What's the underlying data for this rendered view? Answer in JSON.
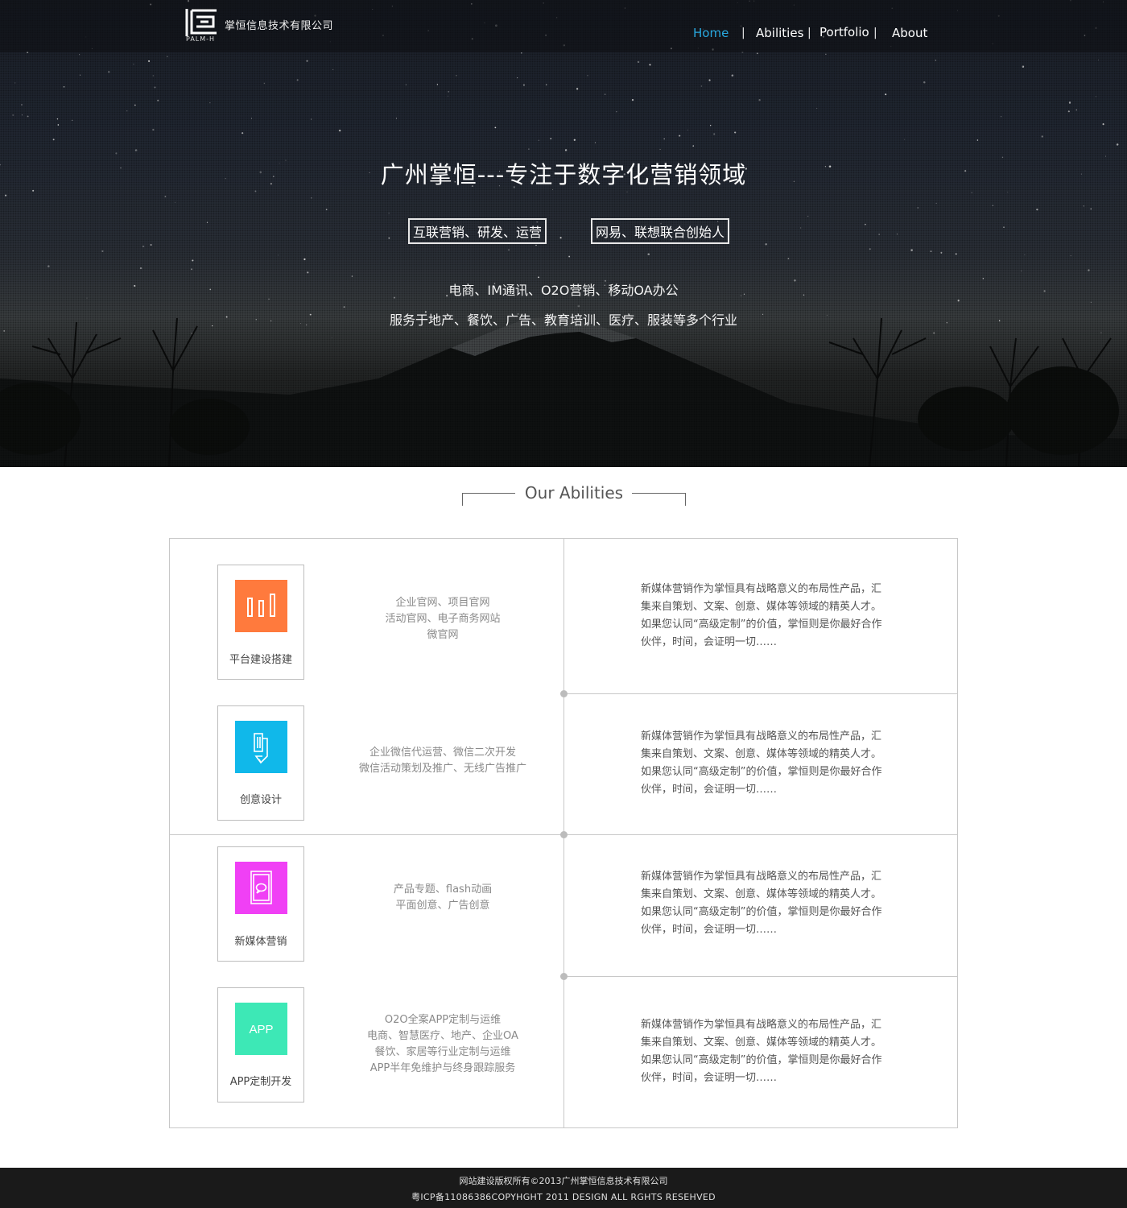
{
  "header": {
    "logo_sub": "PALM-H",
    "brand": "掌恒信息技术有限公司",
    "nav": [
      {
        "label": "Home",
        "active": true
      },
      {
        "label": "Abilities",
        "active": false
      },
      {
        "label": "Portfolio",
        "active": false
      },
      {
        "label": "About",
        "active": false
      }
    ],
    "separator": "|"
  },
  "hero": {
    "title": "广州掌恒---专注于数字化营销领域",
    "tags": [
      "互联营销、研发、运营",
      "网易、联想联合创始人"
    ],
    "lines": [
      "电商、IM通讯、O2O营销、移动OA办公",
      "服务于地产、餐饮、广告、教育培训、医疗、服装等多个行业"
    ]
  },
  "abilities": {
    "title": "Our Abilities",
    "items": [
      {
        "icon": "bar-chart-icon",
        "color": "#ff7a3d",
        "label": "平台建设搭建",
        "desc": [
          "企业官网、项目官网",
          "活动官网、电子商务网站",
          "微官网"
        ],
        "para": "新媒体营销作为掌恒具有战略意义的布局性产品，汇集来自策划、文案、创意、媒体等领域的精英人才。如果您认同“高级定制”的价值，掌恒则是你最好合作伙伴，时间，会证明一切……"
      },
      {
        "icon": "pencil-icon",
        "color": "#10b8ea",
        "label": "创意设计",
        "desc": [
          "企业微信代运营、微信二次开发",
          "微信活动策划及推广、无线广告推广"
        ],
        "para": "新媒体营销作为掌恒具有战略意义的布局性产品，汇集来自策划、文案、创意、媒体等领域的精英人才。如果您认同“高级定制”的价值，掌恒则是你最好合作伙伴，时间，会证明一切……"
      },
      {
        "icon": "phone-chat-icon",
        "color": "#f040f5",
        "label": "新媒体营销",
        "desc": [
          "产品专题、flash动画",
          "平面创意、广告创意"
        ],
        "para": "新媒体营销作为掌恒具有战略意义的布局性产品，汇集来自策划、文案、创意、媒体等领域的精英人才。如果您认同“高级定制”的价值，掌恒则是你最好合作伙伴，时间，会证明一切……"
      },
      {
        "icon": "app-icon",
        "color": "#3de8b6",
        "icon_text": "APP",
        "label": "APP定制开发",
        "desc": [
          "O2O全案APP定制与运维",
          "电商、智慧医疗、地产、企业OA",
          "餐饮、家居等行业定制与运维",
          "APP半年免维护与终身跟踪服务"
        ],
        "para": "新媒体营销作为掌恒具有战略意义的布局性产品，汇集来自策划、文案、创意、媒体等领域的精英人才。如果您认同“高级定制”的价值，掌恒则是你最好合作伙伴，时间，会证明一切……"
      }
    ]
  },
  "footer": {
    "line1": "网站建设版权所有©2013广州掌恒信息技术有限公司",
    "line2": "粤ICP备11086386COPYHGHT  2011  DESIGN  ALL RGHTS  RESEHVED"
  }
}
